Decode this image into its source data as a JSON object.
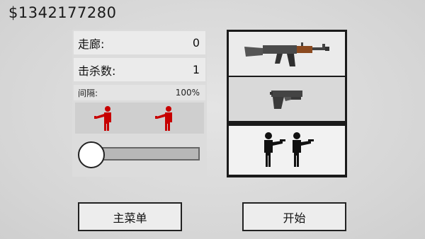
{
  "money": "$1342177280",
  "stats": {
    "corridor_label": "走廊:",
    "corridor_value": "0",
    "kills_label": "击杀数:",
    "kills_value": "1",
    "interval_label": "间隔:",
    "interval_value": "100%",
    "interval_level": 0.0
  },
  "enemies": {
    "count": 2,
    "color": "#cc0000"
  },
  "weapons": {
    "items": [
      {
        "icon": "assault-rifle-icon"
      },
      {
        "icon": "pistol-icon"
      },
      {
        "icon": "shooters-icon"
      }
    ]
  },
  "buttons": {
    "main_menu": "主菜单",
    "start": "开始"
  }
}
